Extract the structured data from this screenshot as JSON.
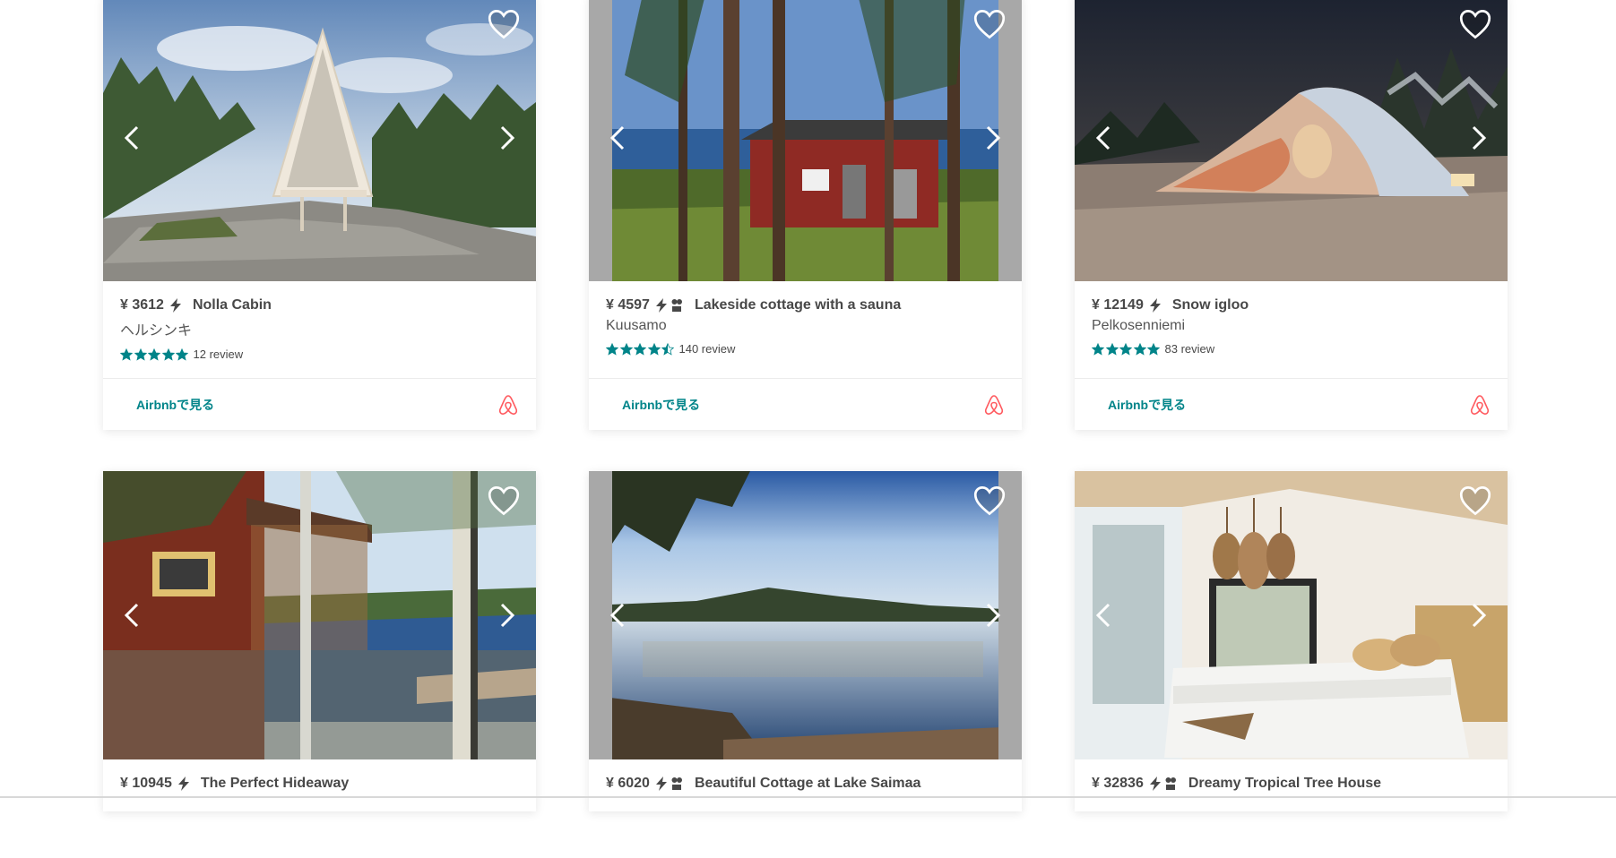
{
  "listings": [
    {
      "price": "¥ 3612",
      "name": "Nolla Cabin",
      "location": "ヘルシンキ",
      "stars": 5,
      "reviews": "12 review",
      "link_label": "Airbnbで見る",
      "instant_book": true,
      "extra_badge": false
    },
    {
      "price": "¥ 4597",
      "name": "Lakeside cottage with a sauna",
      "location": "Kuusamo",
      "stars": 4.5,
      "reviews": "140 review",
      "link_label": "Airbnbで見る",
      "instant_book": true,
      "extra_badge": true
    },
    {
      "price": "¥ 12149",
      "name": "Snow igloo",
      "location": "Pelkosenniemi",
      "stars": 5,
      "reviews": "83 review",
      "link_label": "Airbnbで見る",
      "instant_book": true,
      "extra_badge": false
    },
    {
      "price": "¥ 10945",
      "name": "The Perfect Hideaway",
      "instant_book": true,
      "extra_badge": false
    },
    {
      "price": "¥ 6020",
      "name": "Beautiful Cottage at Lake Saimaa",
      "instant_book": true,
      "extra_badge": true
    },
    {
      "price": "¥ 32836",
      "name": "Dreamy Tropical Tree House",
      "instant_book": true,
      "extra_badge": true
    }
  ],
  "colors": {
    "accent": "#008489",
    "star": "#008489",
    "brand": "#FF5A5F",
    "text": "#484848"
  },
  "icons": {
    "favorite": "heart-outline-icon",
    "prev": "chevron-left-icon",
    "next": "chevron-right-icon",
    "instant": "lightning-bolt-icon",
    "brand": "airbnb-logo-icon"
  }
}
